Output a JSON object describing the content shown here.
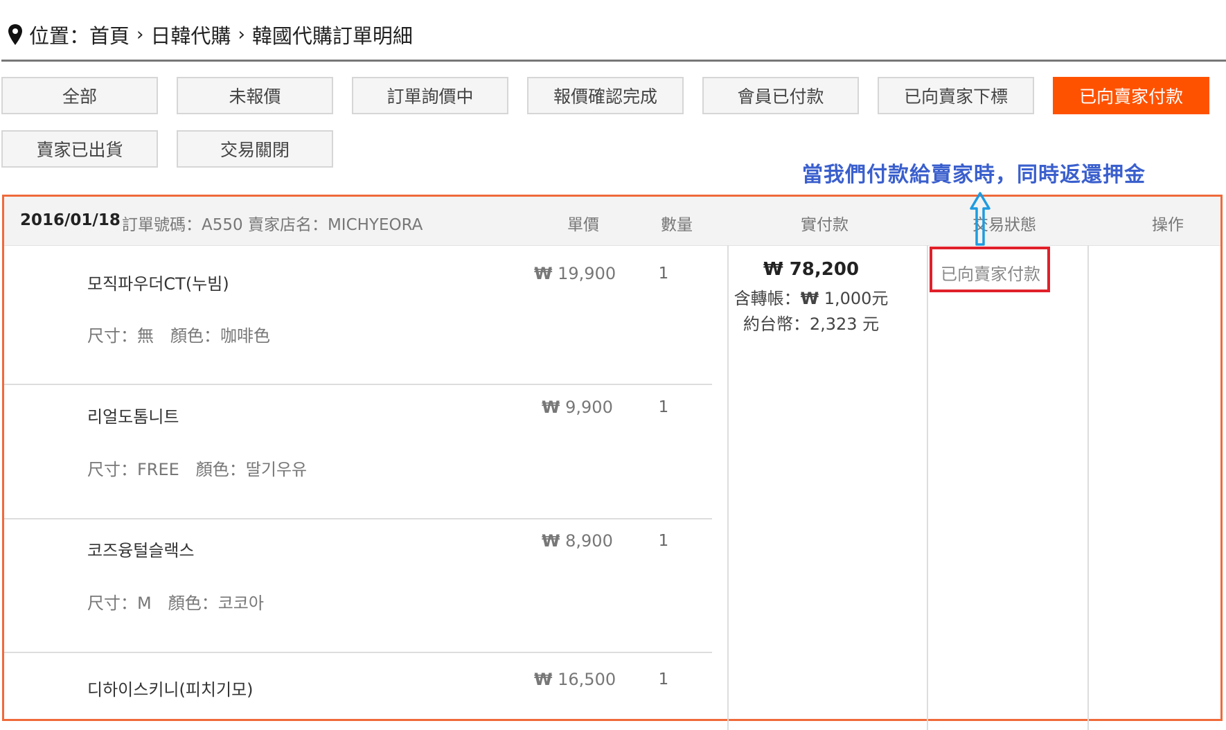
{
  "breadcrumb": {
    "icon": "map-pin-icon",
    "prefix": "位置：首頁",
    "sep": "›",
    "level2": "日韓代購",
    "level3": "韓國代購訂單明細"
  },
  "tabs": [
    {
      "label": "全部",
      "active": false
    },
    {
      "label": "未報價",
      "active": false
    },
    {
      "label": "訂單詢價中",
      "active": false
    },
    {
      "label": "報價確認完成",
      "active": false
    },
    {
      "label": "會員已付款",
      "active": false
    },
    {
      "label": "已向賣家下標",
      "active": false
    },
    {
      "label": "已向賣家付款",
      "active": true
    },
    {
      "label": "賣家已出貨",
      "active": false
    },
    {
      "label": "交易關閉",
      "active": false
    }
  ],
  "annotation": {
    "text": "當我們付款給賣家時，同時返還押金",
    "arrow_icon": "up-arrow-icon",
    "color": "#3a5fcd"
  },
  "order": {
    "date": "2016/01/18",
    "info": "訂單號碼：A550 賣家店名：MICHYEORA",
    "columns": {
      "price": "單價",
      "qty": "數量",
      "paid": "實付款",
      "status": "交易狀態",
      "action": "操作"
    },
    "items": [
      {
        "name": "모직파우더CT(누빔)",
        "spec": "尺寸：無　顏色：咖啡色",
        "currency": "₩",
        "price": "19,900",
        "qty": "1"
      },
      {
        "name": "리얼도톰니트",
        "spec": "尺寸：FREE　顏色：딸기우유",
        "currency": "₩",
        "price": "9,900",
        "qty": "1"
      },
      {
        "name": "코즈융털슬랙스",
        "spec": "尺寸：M　顏色：코코아",
        "currency": "₩",
        "price": "8,900",
        "qty": "1"
      },
      {
        "name": "디하이스키니(피치기모)",
        "spec": "",
        "currency": "₩",
        "price": "16,500",
        "qty": "1"
      }
    ],
    "payment": {
      "currency": "₩",
      "total": "78,200",
      "fee_label": "含轉帳：",
      "fee": "1,000元",
      "twd_label": "約台幣：",
      "twd": "2,323 元"
    },
    "status": "已向賣家付款",
    "status_highlight_color": "#e0202a"
  },
  "colors": {
    "accent": "#ff5200",
    "order_border": "#ef6a3a"
  }
}
